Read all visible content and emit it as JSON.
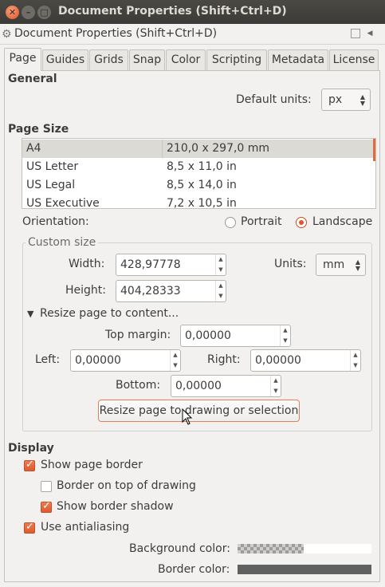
{
  "window": {
    "title": "Document Properties (Shift+Ctrl+D)"
  },
  "dock": {
    "title": "Document Properties (Shift+Ctrl+D)"
  },
  "tabs": [
    "Page",
    "Guides",
    "Grids",
    "Snap",
    "Color",
    "Scripting",
    "Metadata",
    "License"
  ],
  "general": {
    "heading": "General",
    "default_units_label": "Default units:",
    "default_units_value": "px"
  },
  "page_size": {
    "heading": "Page Size",
    "rows": [
      {
        "name": "A4",
        "size": "210,0 x 297,0 mm"
      },
      {
        "name": "US Letter",
        "size": "8,5 x 11,0 in"
      },
      {
        "name": "US Legal",
        "size": "8,5 x 14,0 in"
      },
      {
        "name": "US Executive",
        "size": "7,2 x 10,5 in"
      }
    ]
  },
  "orientation": {
    "label": "Orientation:",
    "portrait": "Portrait",
    "landscape": "Landscape",
    "selected": "Landscape"
  },
  "custom_size": {
    "title": "Custom size",
    "width_label": "Width:",
    "width_value": "428,97778",
    "height_label": "Height:",
    "height_value": "404,28333",
    "units_label": "Units:",
    "units_value": "mm",
    "resize_expander": "Resize page to content...",
    "top_margin_label": "Top margin:",
    "top_margin_value": "0,00000",
    "left_label": "Left:",
    "left_value": "0,00000",
    "right_label": "Right:",
    "right_value": "0,00000",
    "bottom_label": "Bottom:",
    "bottom_value": "0,00000",
    "resize_button": "Resize page to drawing or selection"
  },
  "display": {
    "heading": "Display",
    "show_page_border": "Show page border",
    "border_on_top": "Border on top of drawing",
    "show_border_shadow": "Show border shadow",
    "use_antialiasing": "Use antialiasing",
    "background_color_label": "Background color:",
    "border_color_label": "Border color:",
    "border_color": "#606060"
  },
  "icons": {
    "accent": "#e0552b"
  }
}
